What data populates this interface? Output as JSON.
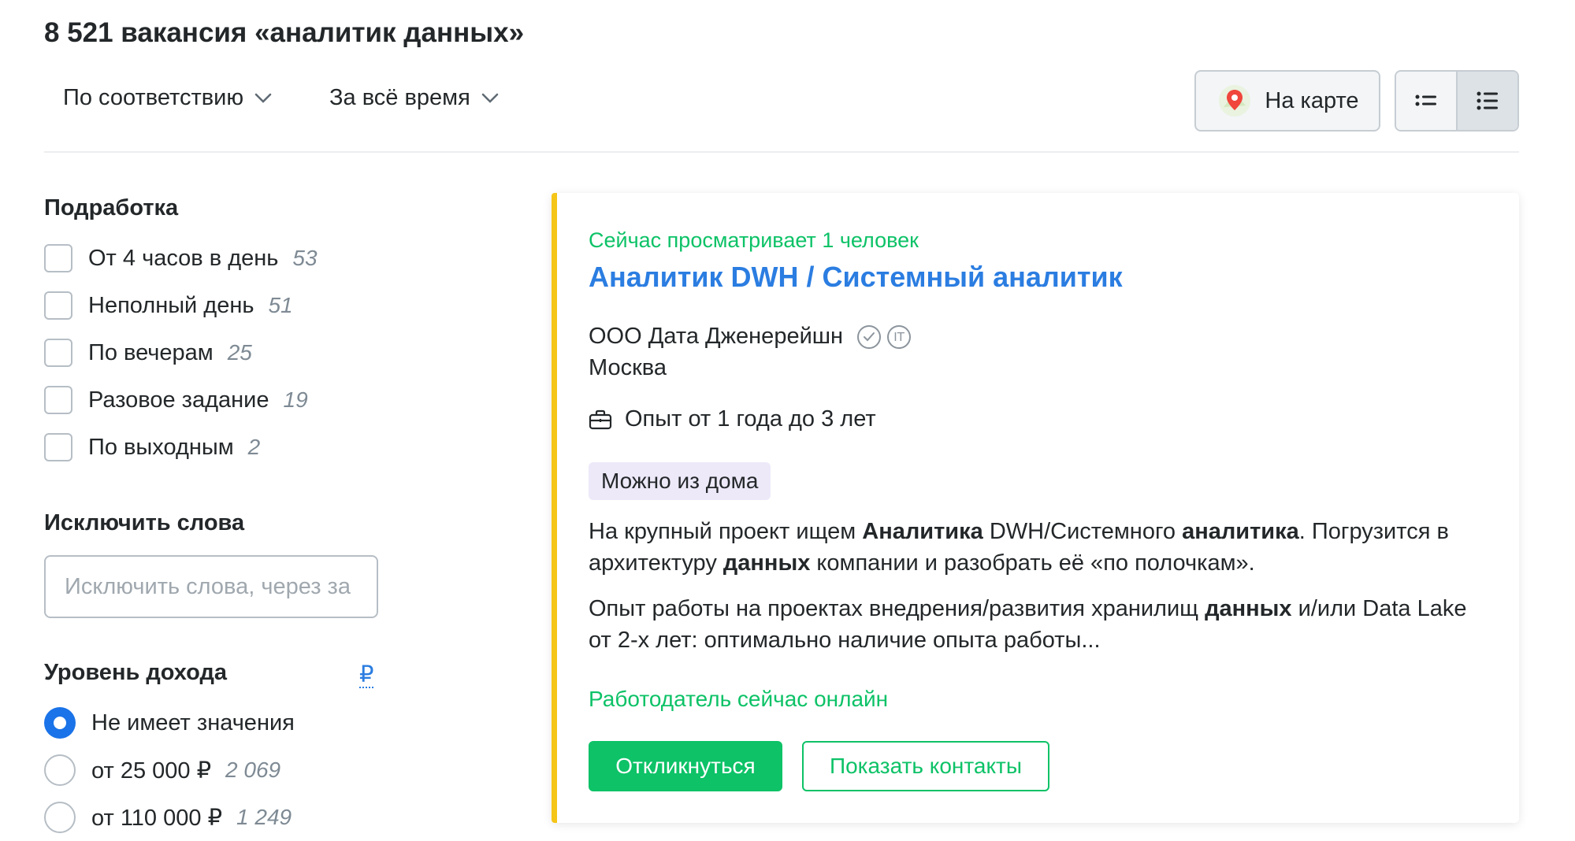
{
  "header": {
    "title": "8 521 вакансия «аналитик данных»",
    "sort_order": "По соответствию",
    "sort_period": "За всё время",
    "map_button": "На карте"
  },
  "sidebar": {
    "part_time": {
      "title": "Подработка",
      "items": [
        {
          "label": "От 4 часов в день",
          "count": "53"
        },
        {
          "label": "Неполный день",
          "count": "51"
        },
        {
          "label": "По вечерам",
          "count": "25"
        },
        {
          "label": "Разовое задание",
          "count": "19"
        },
        {
          "label": "По выходным",
          "count": "2"
        }
      ]
    },
    "exclude": {
      "title": "Исключить слова",
      "placeholder": "Исключить слова, через за",
      "value": ""
    },
    "income": {
      "title": "Уровень дохода",
      "currency": "₽",
      "options": [
        {
          "label": "Не имеет значения",
          "count": "",
          "selected": true
        },
        {
          "label": "от 25 000 ₽",
          "count": "2 069",
          "selected": false
        },
        {
          "label": "от 110 000 ₽",
          "count": "1 249",
          "selected": false
        }
      ]
    }
  },
  "vacancy": {
    "viewers": "Сейчас просматривает 1 человек",
    "title": "Аналитик DWH / Системный аналитик",
    "company": "ООО Дата Дженерейшн",
    "it_badge": "IT",
    "city": "Москва",
    "experience": "Опыт от 1 года до 3 лет",
    "remote_tag": "Можно из дома",
    "snippet1": [
      {
        "text": "На крупный проект ищем ",
        "bold": false
      },
      {
        "text": "Аналитика",
        "bold": true
      },
      {
        "text": " DWH/Системного ",
        "bold": false
      },
      {
        "text": "аналитика",
        "bold": true
      },
      {
        "text": ". Погрузится в архитектуру ",
        "bold": false
      },
      {
        "text": "данных",
        "bold": true
      },
      {
        "text": " компании и разобрать её «по полочкам».",
        "bold": false
      }
    ],
    "snippet2": [
      {
        "text": "Опыт работы на проектах внедрения/развития хранилищ ",
        "bold": false
      },
      {
        "text": "данных",
        "bold": true
      },
      {
        "text": " и/или Data Lake от 2-х лет: оптимально наличие опыта работы...",
        "bold": false
      }
    ],
    "employer_online": "Работодатель сейчас онлайн",
    "apply_button": "Откликнуться",
    "contacts_button": "Показать контакты"
  },
  "colors": {
    "green": "#0dc267",
    "link_blue": "#2b7de1",
    "accent_yellow": "#f5c518",
    "radio_blue": "#1a73e8",
    "tag_lilac": "#ede9f9"
  }
}
